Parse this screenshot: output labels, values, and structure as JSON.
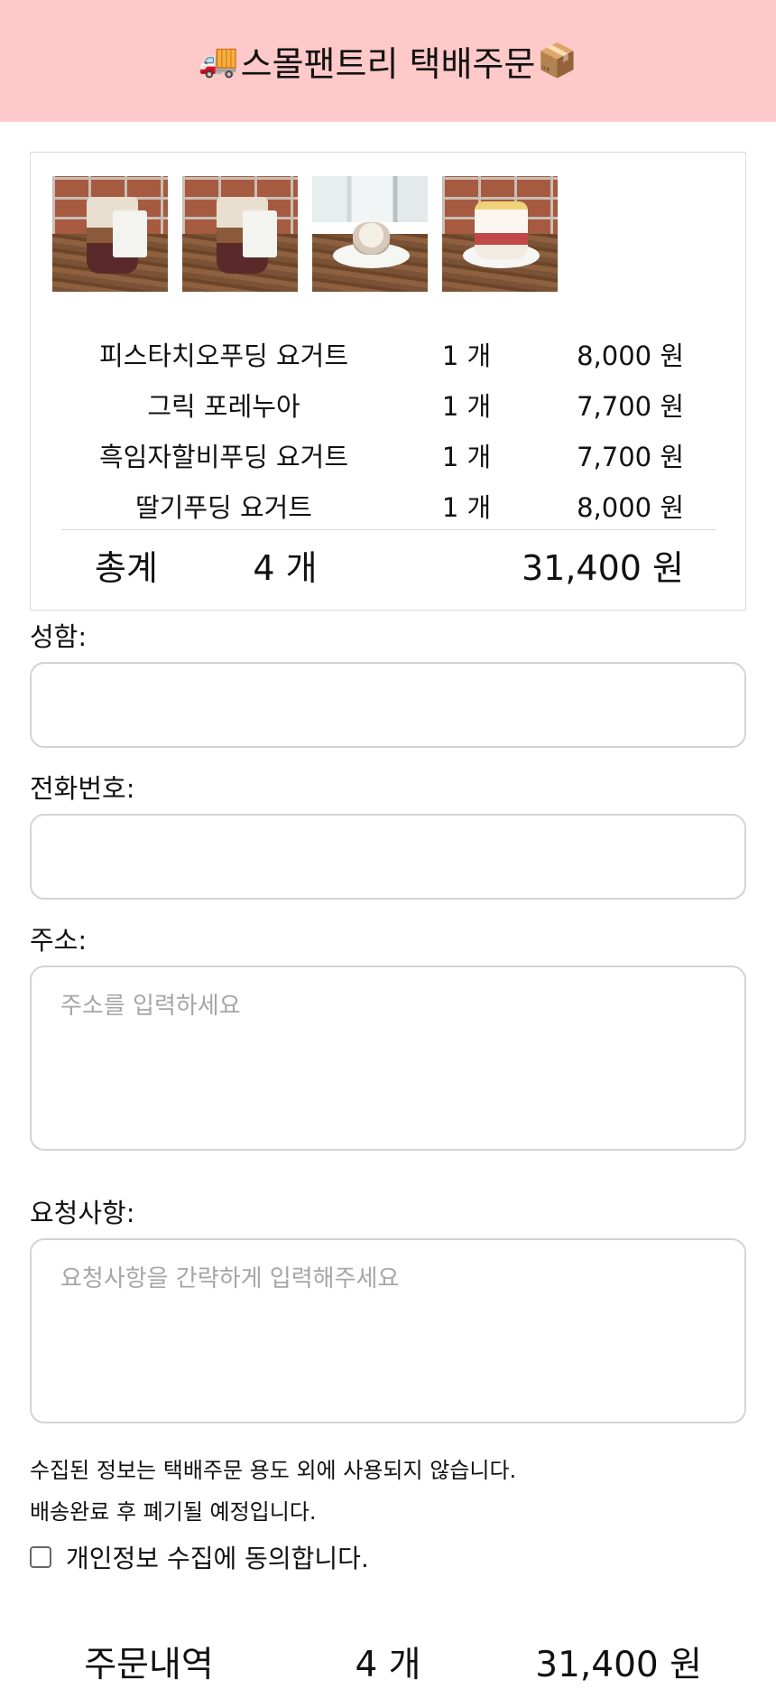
{
  "header": {
    "title": "스몰팬트리 택배주문",
    "left_icon": "delivery-truck-icon",
    "right_icon": "package-icon"
  },
  "cart": {
    "items": [
      {
        "name": "피스타치오푸딩 요거트",
        "qty": "1 개",
        "price": "8,000 원"
      },
      {
        "name": "그릭 포레누아",
        "qty": "1 개",
        "price": "7,700 원"
      },
      {
        "name": "흑임자할비푸딩 요거트",
        "qty": "1 개",
        "price": "7,700 원"
      },
      {
        "name": "딸기푸딩 요거트",
        "qty": "1 개",
        "price": "8,000 원"
      }
    ],
    "total": {
      "label": "총계",
      "qty": "4 개",
      "price": "31,400 원"
    }
  },
  "form": {
    "name_label": "성함:",
    "phone_label": "전화번호:",
    "address_label": "주소:",
    "address_placeholder": "주소를 입력하세요",
    "request_label": "요청사항:",
    "request_placeholder": "요청사항을 간략하게 입력해주세요"
  },
  "notice": {
    "line1": "수집된 정보는 택배주문 용도 외에 사용되지 않습니다.",
    "line2": "배송완료 후 폐기될 예정입니다.",
    "agree_label": "개인정보 수집에 동의합니다."
  },
  "summary": {
    "label": "주문내역",
    "qty": "4 개",
    "price": "31,400 원"
  },
  "colors": {
    "header_bg": "#ffc9c9",
    "border": "#d3d3d3",
    "placeholder": "#a6a6a6"
  }
}
